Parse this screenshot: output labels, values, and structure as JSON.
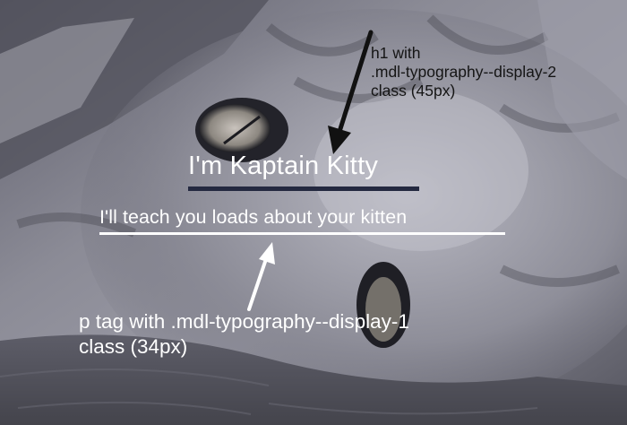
{
  "heading": {
    "text": "I'm Kaptain Kitty"
  },
  "subheading": {
    "text": "I'll teach you loads about your kitten"
  },
  "annotations": {
    "h1_note": {
      "line1": "h1 with",
      "line2": ".mdl-typography--display-2",
      "line3": "class (45px)"
    },
    "p_note": {
      "line1": "p tag with .mdl-typography--display-1",
      "line2": "class (34px)"
    }
  },
  "colors": {
    "photo_tint": "#6e6e7c",
    "dark_arrow": "#111111",
    "light_arrow": "#ffffff",
    "title_underline": "#242940"
  }
}
